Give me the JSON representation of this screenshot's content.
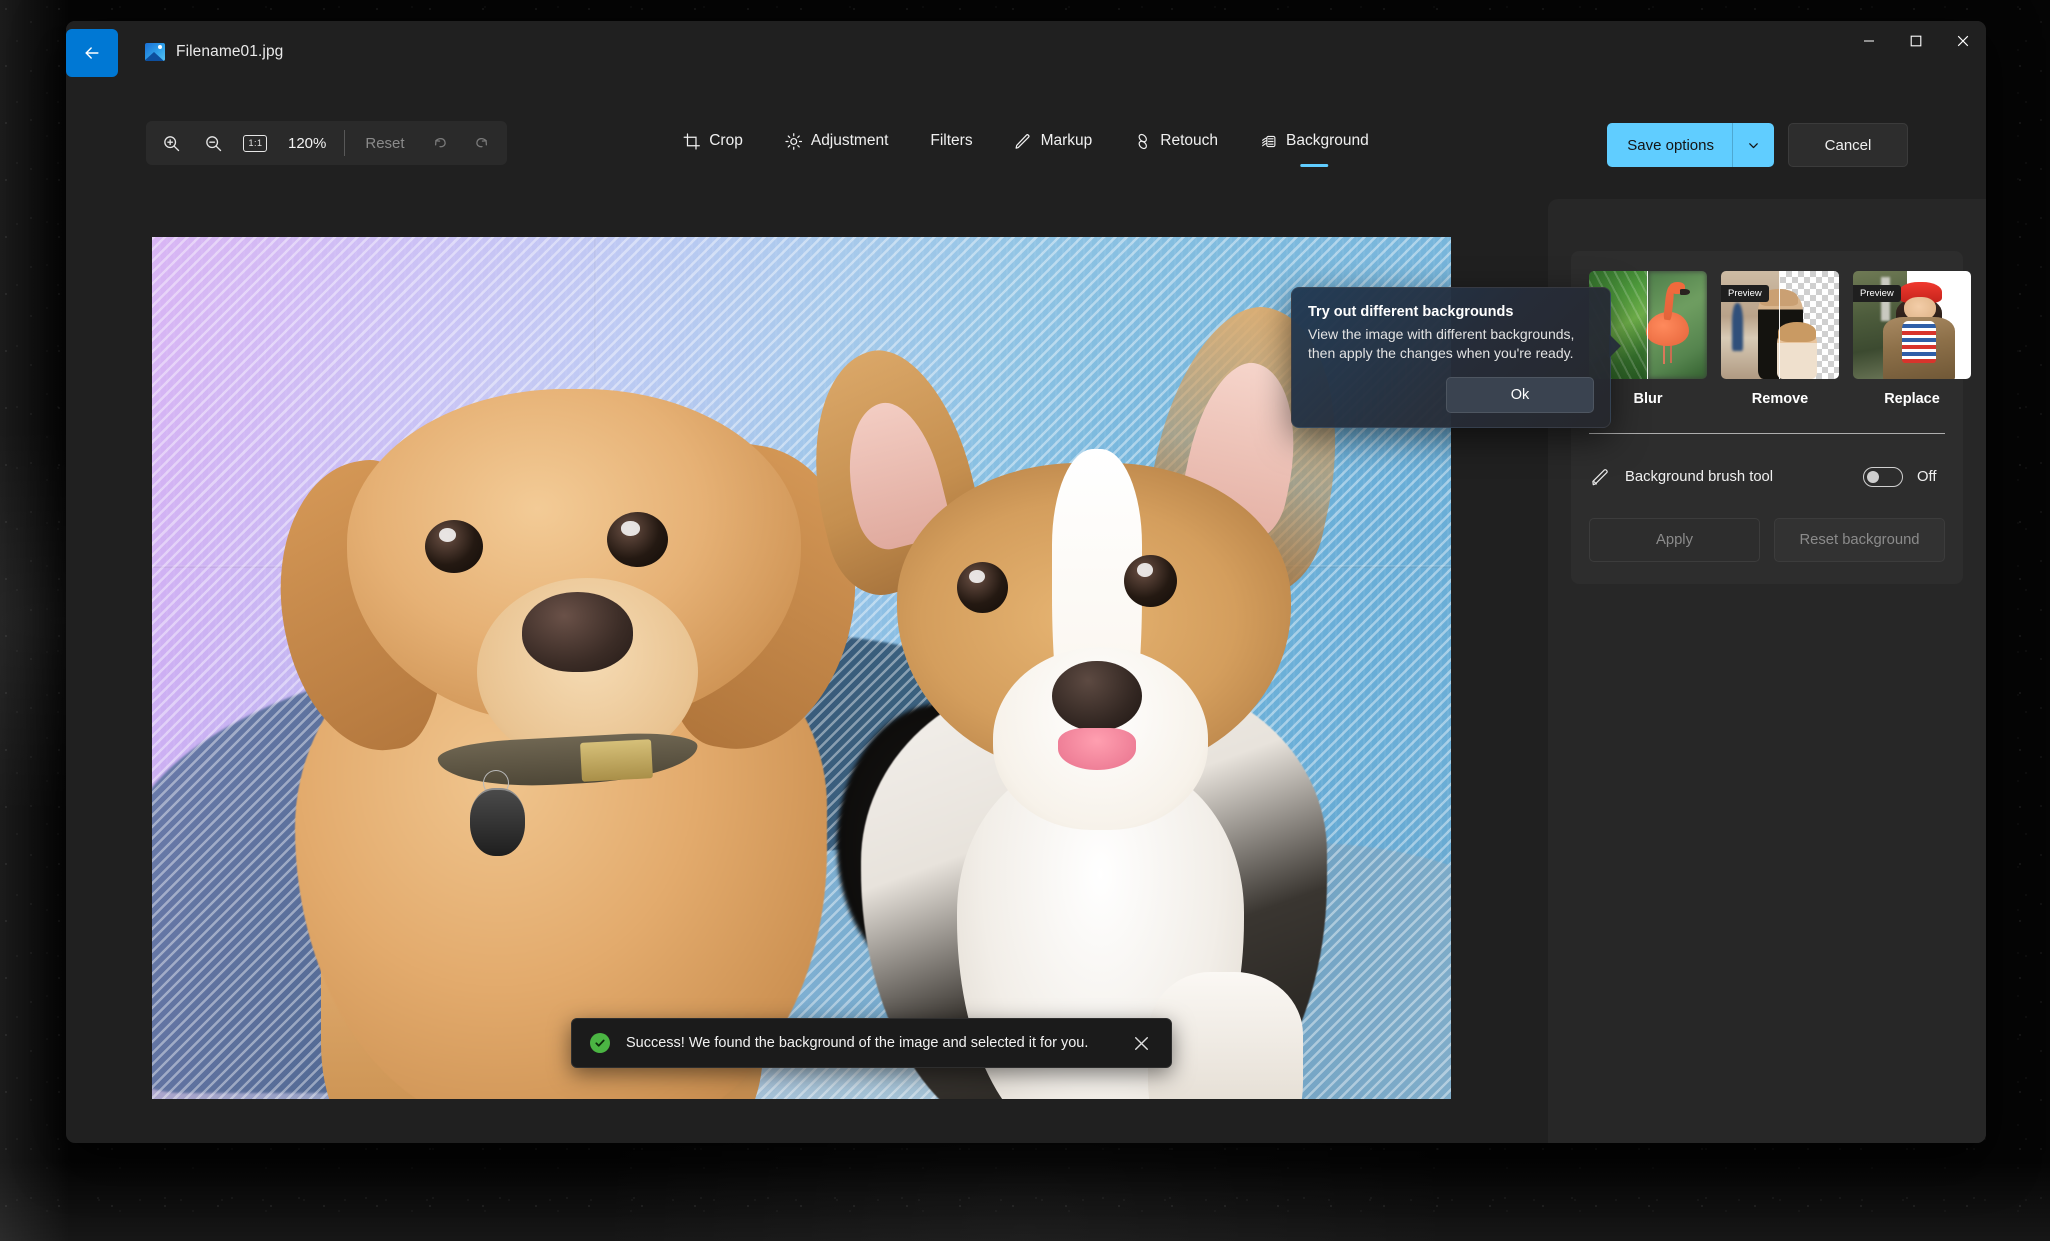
{
  "window": {
    "title": "Filename01.jpg",
    "back_label": "Back",
    "controls": {
      "minimize": "Minimize",
      "maximize": "Maximize",
      "close": "Close"
    }
  },
  "toolbar": {
    "zoom_in": "Zoom in",
    "zoom_out": "Zoom out",
    "actual_size": "1:1",
    "zoom_level": "120%",
    "reset": "Reset",
    "undo": "Undo",
    "redo": "Redo"
  },
  "tabs": [
    {
      "label": "Crop",
      "icon": "crop-icon",
      "active": false
    },
    {
      "label": "Adjustment",
      "icon": "brightness-icon",
      "active": false
    },
    {
      "label": "Filters",
      "icon": "",
      "active": false
    },
    {
      "label": "Markup",
      "icon": "pencil-icon",
      "active": false
    },
    {
      "label": "Retouch",
      "icon": "retouch-icon",
      "active": false
    },
    {
      "label": "Background",
      "icon": "background-icon",
      "active": true
    }
  ],
  "actions": {
    "save_options": "Save options",
    "save_caret": "chevron-down-icon",
    "cancel": "Cancel"
  },
  "teaching_tip": {
    "title": "Try out different backgrounds",
    "body": "View the image with different backgrounds, then apply the changes when you're ready.",
    "ok": "Ok"
  },
  "toast": {
    "message": "Success! We found the background of the image and selected it for you.",
    "icon": "success-check-icon",
    "close": "close-icon",
    "accent": "#4bb543"
  },
  "background_panel": {
    "options": [
      {
        "label": "Blur",
        "badge": ""
      },
      {
        "label": "Remove",
        "badge": "Preview"
      },
      {
        "label": "Replace",
        "badge": "Preview"
      }
    ],
    "brush_tool": {
      "label": "Background brush tool",
      "icon": "brush-icon",
      "state": "Off"
    },
    "buttons": {
      "apply": "Apply",
      "reset": "Reset background"
    }
  },
  "colors": {
    "accent": "#60cdff",
    "back_button": "#0078d4",
    "window_bg": "#202020",
    "panel_bg": "#272727",
    "card_bg": "#2d2d2d",
    "success": "#4bb543"
  }
}
